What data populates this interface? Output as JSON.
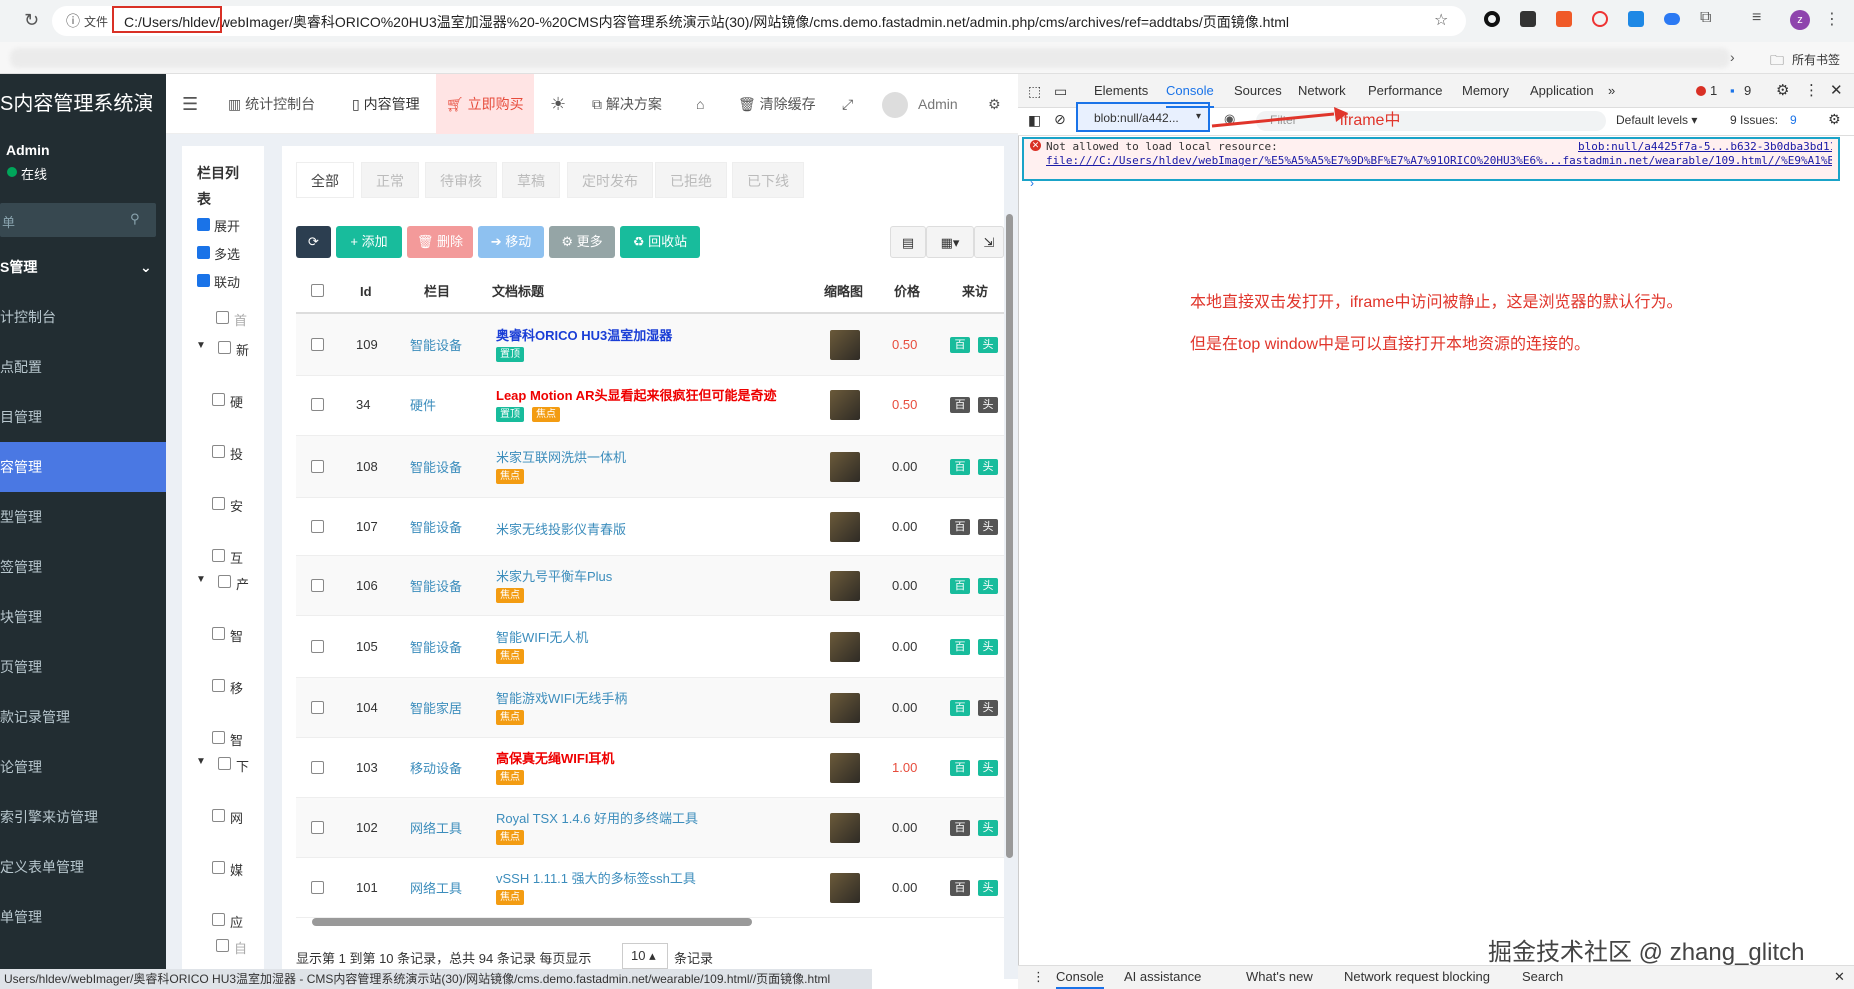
{
  "browser": {
    "file_label": "文件",
    "url": "C:/Users/hldev/webImager/奥睿科ORICO%20HU3温室加湿器%20-%20CMS内容管理系统演示站(30)/网站镜像/cms.demo.fastadmin.net/admin.php/cms/archives/ref=addtabs/页面镜像.html",
    "bookmarks_label": "所有书签"
  },
  "sidebar": {
    "brand": "S内容管理系统演",
    "user": "Admin",
    "status": "在线",
    "search_placeholder": "单",
    "items": [
      {
        "label": "S管理",
        "active": false
      },
      {
        "label": "计控制台",
        "active": false
      },
      {
        "label": "点配置",
        "active": false
      },
      {
        "label": "目管理",
        "active": false
      },
      {
        "label": "容管理",
        "active": true
      },
      {
        "label": "型管理",
        "active": false
      },
      {
        "label": "签管理",
        "active": false
      },
      {
        "label": "块管理",
        "active": false
      },
      {
        "label": "页管理",
        "active": false
      },
      {
        "label": "款记录管理",
        "active": false
      },
      {
        "label": "论管理",
        "active": false
      },
      {
        "label": "索引擎来访管理",
        "active": false
      },
      {
        "label": "定义表单管理",
        "active": false
      },
      {
        "label": "单管理",
        "active": false
      }
    ]
  },
  "topnav": {
    "dashboard": "统计控制台",
    "content": "内容管理",
    "buy": "立即购买",
    "solutions": "解决方案",
    "clear_cache": "清除缓存",
    "admin": "Admin"
  },
  "tree": {
    "title": "栏目列表",
    "options": [
      "展开",
      "多选",
      "联动"
    ],
    "nodes": [
      "首",
      "新",
      "硬",
      "投",
      "安",
      "互",
      "产",
      "智",
      "移",
      "智",
      "下",
      "网",
      "媒",
      "应",
      "自"
    ]
  },
  "tabs": [
    "全部",
    "正常",
    "待审核",
    "草稿",
    "定时发布",
    "已拒绝",
    "已下线"
  ],
  "toolbar": {
    "add": "添加",
    "delete": "删除",
    "move": "移动",
    "more": "更多",
    "recycle": "回收站"
  },
  "table": {
    "headers": [
      "Id",
      "栏目",
      "文档标题",
      "缩略图",
      "价格",
      "来访"
    ],
    "rows": [
      {
        "id": "109",
        "category": "智能设备",
        "title": "奥睿科ORICO HU3温室加湿器",
        "title_style": "bold-blue",
        "badges": [
          "置顶"
        ],
        "price": "0.50",
        "price_red": true
      },
      {
        "id": "34",
        "category": "硬件",
        "title": "Leap Motion AR头显看起来很疯狂但可能是奇迹",
        "title_style": "bold-red",
        "badges": [
          "置顶",
          "焦点"
        ],
        "price": "0.50",
        "price_red": true
      },
      {
        "id": "108",
        "category": "智能设备",
        "title": "米家互联网洗烘一体机",
        "title_style": "normal",
        "badges": [
          "焦点"
        ],
        "price": "0.00",
        "price_red": false
      },
      {
        "id": "107",
        "category": "智能设备",
        "title": "米家无线投影仪青春版",
        "title_style": "normal",
        "badges": [],
        "price": "0.00",
        "price_red": false
      },
      {
        "id": "106",
        "category": "智能设备",
        "title": "米家九号平衡车Plus",
        "title_style": "normal",
        "badges": [
          "焦点"
        ],
        "price": "0.00",
        "price_red": false
      },
      {
        "id": "105",
        "category": "智能设备",
        "title": "智能WIFI无人机",
        "title_style": "normal",
        "badges": [
          "焦点"
        ],
        "price": "0.00",
        "price_red": false
      },
      {
        "id": "104",
        "category": "智能家居",
        "title": "智能游戏WIFI无线手柄",
        "title_style": "normal",
        "badges": [
          "焦点"
        ],
        "price": "0.00",
        "price_red": false
      },
      {
        "id": "103",
        "category": "移动设备",
        "title": "高保真无绳WIFI耳机",
        "title_style": "bold-red",
        "badges": [
          "焦点"
        ],
        "price": "1.00",
        "price_red": true
      },
      {
        "id": "102",
        "category": "网络工具",
        "title": "Royal TSX 1.4.6 好用的多终端工具",
        "title_style": "normal",
        "badges": [
          "焦点"
        ],
        "price": "0.00",
        "price_red": false
      },
      {
        "id": "101",
        "category": "网络工具",
        "title": "vSSH 1.11.1 强大的多标签ssh工具",
        "title_style": "normal",
        "badges": [
          "焦点"
        ],
        "price": "0.00",
        "price_red": false
      }
    ],
    "visit_tags": [
      "百",
      "头"
    ],
    "footer_text": "显示第 1 到第 10 条记录，总共 94 条记录 每页显示",
    "page_size": "10",
    "footer_suffix": "条记录"
  },
  "devtools": {
    "tabs": [
      "Elements",
      "Console",
      "Sources",
      "Network",
      "Performance",
      "Memory",
      "Application"
    ],
    "active_tab": "Console",
    "error_count": "1",
    "message_count": "9",
    "context": "blob:null/a442...",
    "filter_placeholder": "Filter",
    "levels": "Default levels",
    "issues": "9 Issues:",
    "issues_count": "9",
    "error_text": "Not allowed to load local resource:",
    "error_url": "file:///C:/Users/hldev/webImager/%E5%A5%A5%E7%9D%BF%E7%A7%91ORICO%20HU3%E6%...fastadmin.net/wearable/109.html//%E9%A1%B5%E9%9D%A2...",
    "error_source": "blob:null/a4425f7a-5...b632-3b0dba3bd112:1",
    "annotation_label": "iframe中",
    "annotation_line1": "本地直接双击发打开，iframe中访问被静止，这是浏览器的默认行为。",
    "annotation_line2": "但是在top window中是可以直接打开本地资源的连接的。",
    "watermark": "掘金技术社区 @ zhang_glitch",
    "bottom_tabs": [
      "Console",
      "AI assistance",
      "What's new",
      "Network request blocking",
      "Search"
    ]
  },
  "statusbar": "Users/hldev/webImager/奥睿科ORICO HU3温室加湿器 - CMS内容管理系统演示站(30)/网站镜像/cms.demo.fastadmin.net/wearable/109.html//页面镜像.html",
  "colors": {
    "sidebar_bg": "#222d32",
    "active_blue": "#4a78e3",
    "green": "#18bc9c",
    "red_btn": "#f39a9a",
    "blue_btn": "#8ec1f0",
    "gray_btn": "#95a5a6",
    "dark_btn": "#2c3e50",
    "badge_green": "#18bc9c",
    "badge_orange": "#f39c12",
    "annotation_red": "#e0352b"
  }
}
